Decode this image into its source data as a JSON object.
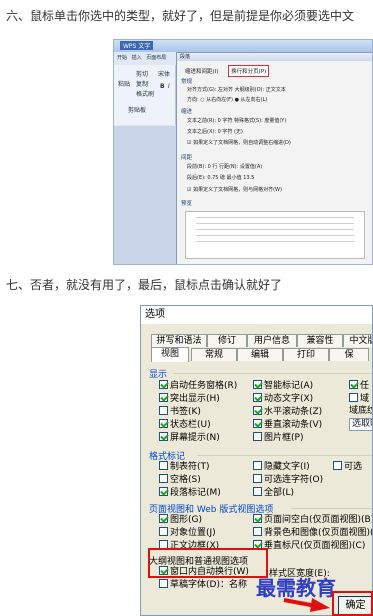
{
  "steps": {
    "step6": "六、鼠标单击你选中的类型，就好了，但是前提是你必须要选中文",
    "step7": "七、否者，就没有用了，最后，鼠标点击确认就好了"
  },
  "shot1": {
    "app_title": "WPS 文字",
    "ribbon_tabs": [
      "开始",
      "插入",
      "页面布局"
    ],
    "ribbon_labels": [
      "粘贴",
      "剪切",
      "复制",
      "格式刷",
      "剪贴板",
      "宋体",
      "B",
      "I"
    ],
    "dialog_title": "段落",
    "tabs": [
      "缩进和间距(I)",
      "换行和分页(P)"
    ],
    "highlighted_tab": "换行和分页(P)",
    "sections": [
      "常规",
      "缩进",
      "间距",
      "预览"
    ],
    "rows": [
      "对齐方式(G): 左对齐    大纲级别(O): 正文文本",
      "方向:  ○ 从右向左(F)  ● 从左向右(L)",
      "文本之前(R): 0    字符   特殊格式(S):   度量值(Y)",
      "文本之后(X): 0    字符   (无)",
      "☑ 如果定义了文档网格，则自动调整右缩进(D)",
      "段前(B): 0    行   行距(N):    设置值(A)",
      "段后(E): 0.75   磅   最小值    13.5",
      "☑ 如果定义了文档网格，则与网格对齐(W)"
    ]
  },
  "shot2": {
    "title": "选项",
    "tabs_row1": [
      "拼写和语法",
      "修订",
      "用户信息",
      "兼容性",
      "中文版"
    ],
    "tabs_row2": [
      "视图",
      "常规",
      "编辑",
      "打印",
      "保"
    ],
    "groups": {
      "display": "显示",
      "format_marks": "格式标记",
      "page_web": "页面视图和 Web 版式视图选项",
      "outline": "大纲视图和普通视图选项"
    },
    "display_items": [
      {
        "label": "启动任务窗格(R)",
        "checked": true
      },
      {
        "label": "突出显示(H)",
        "checked": true
      },
      {
        "label": "书签(K)",
        "checked": false
      },
      {
        "label": "状态栏(U)",
        "checked": true
      },
      {
        "label": "屏幕提示(N)",
        "checked": true
      },
      {
        "label": "智能标记(A)",
        "checked": true
      },
      {
        "label": "动态文字(X)",
        "checked": true
      },
      {
        "label": "水平滚动条(Z)",
        "checked": true
      },
      {
        "label": "垂直滚动条(V)",
        "checked": true
      },
      {
        "label": "图片框(P)",
        "checked": false
      },
      {
        "label": "任",
        "checked": true
      },
      {
        "label": "域",
        "checked": false
      }
    ],
    "field_shading_label": "域底纹",
    "field_shading_value": "选取时",
    "format_items": [
      {
        "label": "制表符(T)",
        "checked": false
      },
      {
        "label": "空格(S)",
        "checked": false
      },
      {
        "label": "段落标记(M)",
        "checked": true
      },
      {
        "label": "隐藏文字(I)",
        "checked": false
      },
      {
        "label": "可选连字符(O)",
        "checked": false
      },
      {
        "label": "全部(L)",
        "checked": false
      },
      {
        "label": "可选",
        "checked": false
      }
    ],
    "page_items": [
      {
        "label": "图形(G)",
        "checked": true
      },
      {
        "label": "对象位置(J)",
        "checked": false
      },
      {
        "label": "正文边框(X)",
        "checked": false
      },
      {
        "label": "页面间空白(仅页面视图)(B)",
        "checked": true
      },
      {
        "label": "背景色和图像(仅页面视图)(B)",
        "checked": false
      },
      {
        "label": "垂直标尺(仅页面视图)(C)",
        "checked": true
      }
    ],
    "outline_items": [
      {
        "label": "窗口内自动换行(W)",
        "checked": true
      },
      {
        "label": "草稿字体(D)：名称",
        "checked": false
      }
    ],
    "style_width_label": "样式区宽度(E):",
    "ok_label": "确定"
  },
  "watermark": "最需教育",
  "colors": {
    "highlight": "#e01010",
    "group_title": "#0046d5",
    "watermark": "#2e3fc6"
  }
}
